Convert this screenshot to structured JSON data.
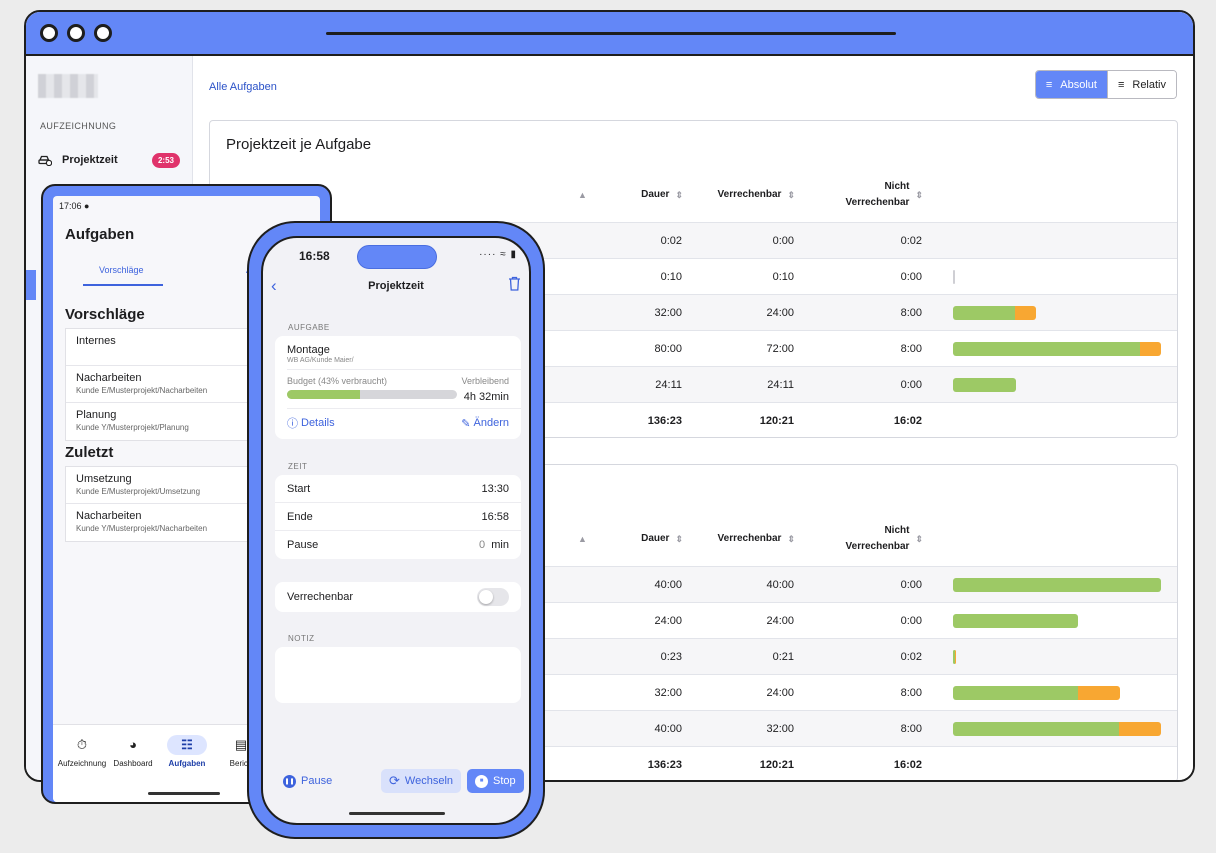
{
  "desktop": {
    "sidebar": {
      "section_label": "AUFZEICHNUNG",
      "item_label": "Projektzeit",
      "item_badge": "2:53"
    },
    "breadcrumb": "Alle Aufgaben",
    "view_toggle": {
      "absolut": "Absolut",
      "relativ": "Relativ"
    },
    "card1": {
      "title": "Projektzeit je Aufgabe",
      "headers": {
        "dauer": "Dauer",
        "verrechenbar": "Verrechenbar",
        "nicht_line1": "Nicht",
        "nicht_line2": "Verrechenbar"
      },
      "rows": [
        {
          "dauer": "0:02",
          "verrechenbar": "0:00",
          "nicht": "0:02",
          "bar_billable": 0,
          "bar_nonbillable": 0
        },
        {
          "dauer": "0:10",
          "verrechenbar": "0:10",
          "nicht": "0:00",
          "bar_billable": 0.0021,
          "bar_nonbillable": 0
        },
        {
          "dauer": "32:00",
          "verrechenbar": "24:00",
          "nicht": "8:00",
          "bar_billable": 0.3,
          "bar_nonbillable": 0.1
        },
        {
          "dauer": "80:00",
          "verrechenbar": "72:00",
          "nicht": "8:00",
          "bar_billable": 0.9,
          "bar_nonbillable": 0.1
        },
        {
          "dauer": "24:11",
          "verrechenbar": "24:11",
          "nicht": "0:00",
          "bar_billable": 0.302,
          "bar_nonbillable": 0
        }
      ],
      "total": {
        "dauer": "136:23",
        "verrechenbar": "120:21",
        "nicht": "16:02"
      }
    },
    "card2": {
      "headers": {
        "dauer": "Dauer",
        "verrechenbar": "Verrechenbar",
        "nicht_line1": "Nicht",
        "nicht_line2": "Verrechenbar"
      },
      "rows": [
        {
          "dauer": "40:00",
          "verrechenbar": "40:00",
          "nicht": "0:00",
          "bar_billable": 1.0,
          "bar_nonbillable": 0
        },
        {
          "dauer": "24:00",
          "verrechenbar": "24:00",
          "nicht": "0:00",
          "bar_billable": 0.6,
          "bar_nonbillable": 0
        },
        {
          "dauer": "0:23",
          "verrechenbar": "0:21",
          "nicht": "0:02",
          "bar_billable": 0.009,
          "bar_nonbillable": 0.001
        },
        {
          "dauer": "32:00",
          "verrechenbar": "24:00",
          "nicht": "8:00",
          "bar_billable": 0.6,
          "bar_nonbillable": 0.2
        },
        {
          "dauer": "40:00",
          "verrechenbar": "32:00",
          "nicht": "8:00",
          "bar_billable": 0.8,
          "bar_nonbillable": 0.2
        }
      ],
      "total": {
        "dauer": "136:23",
        "verrechenbar": "120:21",
        "nicht": "16:02"
      }
    },
    "colors": {
      "accent": "#6387f7",
      "billable": "#9dc965",
      "nonbillable": "#f8a732",
      "badge": "#e0336b"
    }
  },
  "tablet": {
    "status_time": "17:06",
    "title": "Aufgaben",
    "tab_active": "Vorschläge",
    "tab_next_partial": "A",
    "section_suggestions": "Vorschläge",
    "suggestions": [
      {
        "name": "Internes",
        "path": ""
      },
      {
        "name": "Nacharbeiten",
        "path": "Kunde E/Musterprojekt/Nacharbeiten"
      },
      {
        "name": "Planung",
        "path": "Kunde Y/Musterprojekt/Planung"
      }
    ],
    "section_recent": "Zuletzt",
    "recent": [
      {
        "name": "Umsetzung",
        "path": "Kunde E/Musterprojekt/Umsetzung"
      },
      {
        "name": "Nacharbeiten",
        "path": "Kunde Y/Musterprojekt/Nacharbeiten"
      }
    ],
    "nav": [
      {
        "label": "Aufzeichnung",
        "icon": "stopwatch-icon"
      },
      {
        "label": "Dashboard",
        "icon": "pie-chart-icon"
      },
      {
        "label": "Aufgaben",
        "icon": "hierarchy-icon"
      },
      {
        "label": "Berich",
        "icon": "report-icon"
      }
    ]
  },
  "phone": {
    "time": "16:58",
    "title": "Projektzeit",
    "section_task": "AUFGABE",
    "task_name": "Montage",
    "task_path": "WB AG/Kunde Maier/",
    "budget_label": "Budget (43% verbraucht)",
    "budget_used": 0.43,
    "remaining_label": "Verbleibend",
    "remaining_value": "4h 32min",
    "details": "Details",
    "change": "Ändern",
    "section_time": "ZEIT",
    "start_label": "Start",
    "start_value": "13:30",
    "end_label": "Ende",
    "end_value": "16:58",
    "pause_label": "Pause",
    "pause_value": "0",
    "pause_unit": "min",
    "billable_label": "Verrechenbar",
    "section_note": "NOTIZ",
    "actions": {
      "pause": "Pause",
      "switch": "Wechseln",
      "stop": "Stop"
    }
  }
}
